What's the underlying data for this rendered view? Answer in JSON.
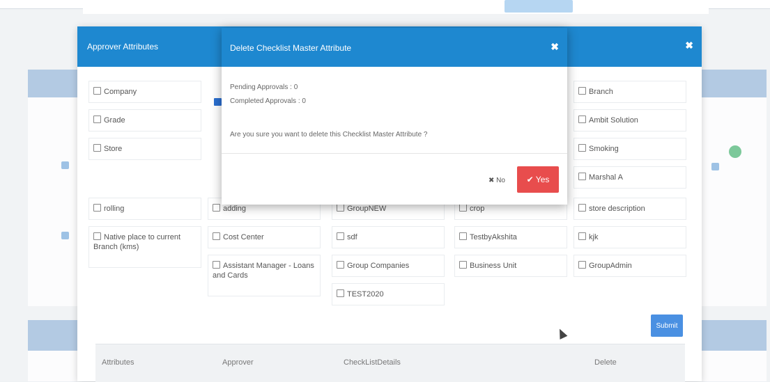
{
  "main_modal": {
    "title": "Approver Attributes",
    "close_icon": "close-icon",
    "submit_label": "Submit",
    "attributes": [
      {
        "label": "Company",
        "checked": false
      },
      {
        "label": "Grade",
        "checked": false
      },
      {
        "label": "Store",
        "checked": false
      },
      {
        "label": "Branch",
        "checked": false
      },
      {
        "label": "Ambit Solution",
        "checked": false
      },
      {
        "label": "Smoking",
        "checked": false
      },
      {
        "label": "Marshal A",
        "checked": false
      },
      {
        "label": "rolling",
        "checked": false
      },
      {
        "label": "adding",
        "checked": false
      },
      {
        "label": "GroupNEW",
        "checked": false
      },
      {
        "label": "crop",
        "checked": false
      },
      {
        "label": "store description",
        "checked": false
      },
      {
        "label": "Native place to current Branch (kms)",
        "checked": false
      },
      {
        "label": "Cost Center",
        "checked": false
      },
      {
        "label": "sdf",
        "checked": false
      },
      {
        "label": "TestbyAkshita",
        "checked": false
      },
      {
        "label": "kjk",
        "checked": false
      },
      {
        "label": "Assistant Manager - Loans and Cards",
        "checked": false
      },
      {
        "label": "Group Companies",
        "checked": false
      },
      {
        "label": "Business Unit",
        "checked": false
      },
      {
        "label": "GroupAdmin",
        "checked": false
      },
      {
        "label": "TEST2020",
        "checked": false
      }
    ],
    "table_headers": [
      "Attributes",
      "Approver",
      "CheckListDetails",
      "Delete"
    ]
  },
  "delete_modal": {
    "title": "Delete Checklist Master Attribute",
    "pending": "Pending Approvals : 0",
    "completed": "Completed Approvals : 0",
    "question": "Are you sure you want to delete this Checklist Master Attribute ?",
    "no_label": "✖ No",
    "yes_label": "✔ Yes"
  },
  "colors": {
    "header_blue": "#1e88d0",
    "danger": "#e84d4d",
    "primary": "#4a90e2"
  }
}
